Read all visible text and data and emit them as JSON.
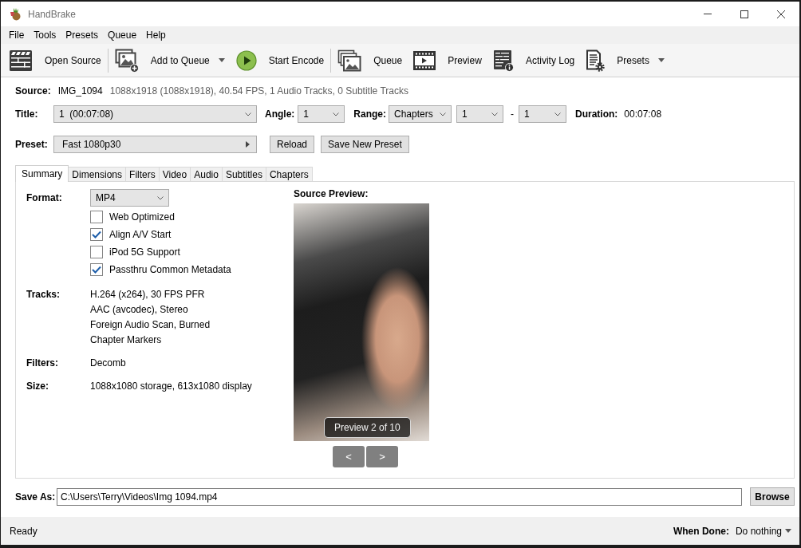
{
  "window": {
    "title": "HandBrake"
  },
  "menu": [
    "File",
    "Tools",
    "Presets",
    "Queue",
    "Help"
  ],
  "toolbar": [
    [
      {
        "label": "Open Source",
        "dropdown": false
      }
    ],
    [
      {
        "label": "Add to Queue",
        "dropdown": true
      },
      {
        "label": "Start Encode",
        "dropdown": false
      }
    ],
    [
      {
        "label": "Queue",
        "dropdown": false
      },
      {
        "label": "Preview",
        "dropdown": false
      },
      {
        "label": "Activity Log",
        "dropdown": false
      },
      {
        "label": "Presets",
        "dropdown": true
      }
    ]
  ],
  "source": {
    "label": "Source:",
    "name": "IMG_1094",
    "details": "1088x1918 (1088x1918), 40.54 FPS, 1 Audio Tracks, 0 Subtitle Tracks"
  },
  "title_row": {
    "title": {
      "label": "Title:",
      "value": "1  (00:07:08)"
    },
    "angle": {
      "label": "Angle:",
      "value": "1"
    },
    "range": {
      "label": "Range:",
      "mode": "Chapters",
      "from": "1",
      "dash": "-",
      "to": "1"
    },
    "duration": {
      "label": "Duration:",
      "value": "00:07:08"
    }
  },
  "preset_row": {
    "label": "Preset:",
    "value": "Fast 1080p30",
    "buttons": [
      "Reload",
      "Save New Preset"
    ]
  },
  "tabs": [
    {
      "label": "Summary",
      "selected": true
    },
    {
      "label": "Dimensions",
      "selected": false
    },
    {
      "label": "Filters",
      "selected": false
    },
    {
      "label": "Video",
      "selected": false
    },
    {
      "label": "Audio",
      "selected": false
    },
    {
      "label": "Subtitles",
      "selected": false
    },
    {
      "label": "Chapters",
      "selected": false
    }
  ],
  "summary": {
    "format": {
      "label": "Format:",
      "value": "MP4"
    },
    "options": [
      {
        "label": "Web Optimized",
        "checked": false
      },
      {
        "label": "Align A/V Start",
        "checked": true
      },
      {
        "label": "iPod 5G Support",
        "checked": false
      },
      {
        "label": "Passthru Common Metadata",
        "checked": true
      }
    ],
    "details": [
      {
        "label": "Tracks:",
        "lines": [
          "H.264 (x264), 30 FPS PFR",
          "AAC (avcodec), Stereo",
          "Foreign Audio Scan, Burned",
          "Chapter Markers"
        ]
      },
      {
        "label": "Filters:",
        "lines": [
          "Decomb"
        ]
      },
      {
        "label": "Size:",
        "lines": [
          "1088x1080 storage, 613x1080 display"
        ]
      }
    ]
  },
  "preview": {
    "title": "Source Preview:",
    "caption": "Preview 2 of 10",
    "buttons": [
      "<",
      ">"
    ]
  },
  "save_as": {
    "label": "Save As:",
    "value": "C:\\Users\\Terry\\Videos\\Img 1094.mp4",
    "button": "Browse"
  },
  "status_bar": {
    "status": "Ready",
    "when_done": {
      "label": "When Done:",
      "value": "Do nothing"
    }
  }
}
